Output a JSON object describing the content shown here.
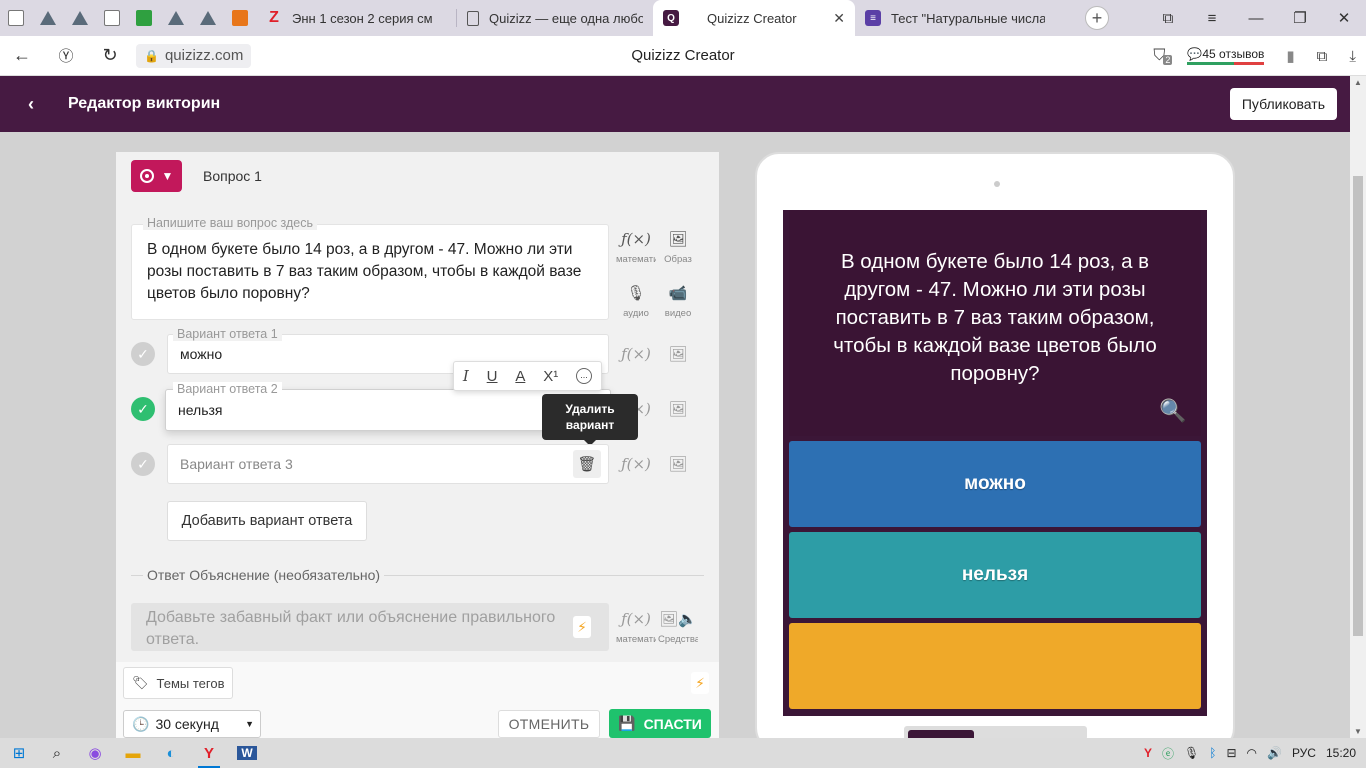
{
  "browser": {
    "mini_tabs": [
      {
        "icon": "white-square-icon",
        "color": "#ffffff"
      },
      {
        "icon": "triangle-logo-icon",
        "color": "#5a6b7a"
      },
      {
        "icon": "triangle-logo-icon",
        "color": "#5a6b7a"
      },
      {
        "icon": "white-square-icon",
        "color": "#ffffff"
      },
      {
        "icon": "green-plus-icon",
        "color": "#2fa040"
      },
      {
        "icon": "triangle-logo-icon",
        "color": "#5a6b7a"
      },
      {
        "icon": "triangle-logo-icon",
        "color": "#5a6b7a"
      },
      {
        "icon": "in-logo-icon",
        "color": "#e8761a"
      }
    ],
    "tabs": [
      {
        "title": "Энн 1 сезон 2 серия см",
        "icon_letter": "Z",
        "icon_color": "#e0202a"
      },
      {
        "title": "Quizizz — еще одна любо",
        "icon_letter": "",
        "icon_color": "#888888"
      },
      {
        "title": "Quizizz Creator",
        "icon_letter": "Q",
        "icon_color": "#461a42",
        "active": true
      },
      {
        "title": "Тест \"Натуральные числа",
        "icon_letter": "≡",
        "icon_color": "#5b3fa6"
      }
    ],
    "new_tab": "+",
    "url": "quizizz.com",
    "page_title": "Quizizz Creator",
    "reviews": "45 отзывов",
    "badge_count": "2"
  },
  "header": {
    "title": "Редактор викторин",
    "publish_label": "Публиковать"
  },
  "editor": {
    "question_number": "Вопрос 1",
    "question_label": "Напишите ваш вопрос здесь",
    "question_text": "В одном букете было 14 роз, а в другом - 47. Можно ли эти розы поставить в 7 ваз таким образом, чтобы в каждой вазе цветов было поровну?",
    "tools": {
      "math": "математика",
      "image": "Образ",
      "audio": "аудио",
      "video": "видео"
    },
    "answers": [
      {
        "label": "Вариант ответа 1",
        "value": "можно",
        "correct": false
      },
      {
        "label": "Вариант ответа 2",
        "value": "нельзя",
        "correct": true
      },
      {
        "label": "",
        "placeholder": "Вариант ответа 3",
        "value": "",
        "correct": false
      }
    ],
    "format_toolbar": [
      "I",
      "U",
      "A",
      "X¹",
      "..."
    ],
    "tooltip": "Удалить вариант",
    "add_answer": "Добавить вариант ответа",
    "explanation_label": "Ответ Объяснение (необязательно)",
    "explanation_placeholder": "Добавьте забавный факт или объяснение правильного ответа.",
    "explanation_tools": {
      "math": "математика",
      "media": "Средства"
    },
    "tags_label": "Темы тегов",
    "timer": "30 секунд",
    "cancel": "ОТМЕНИТЬ",
    "save": "СПАСТИ"
  },
  "preview": {
    "question": "В одном букете было 14 роз, а в другом - 47. Можно ли эти розы поставить в 7 ваз таким образом, чтобы в каждой вазе цветов было поровну?",
    "options": [
      {
        "text": "можно",
        "color": "#2d70b3"
      },
      {
        "text": "нельзя",
        "color": "#2d9da6"
      },
      {
        "text": "",
        "color": "#efa929"
      }
    ]
  },
  "taskbar": {
    "lang": "РУС",
    "time": "15:20"
  },
  "colors": {
    "header_bg": "#461a42",
    "qtype": "#c2185b",
    "correct": "#2fbf71",
    "save": "#1fc26d"
  }
}
